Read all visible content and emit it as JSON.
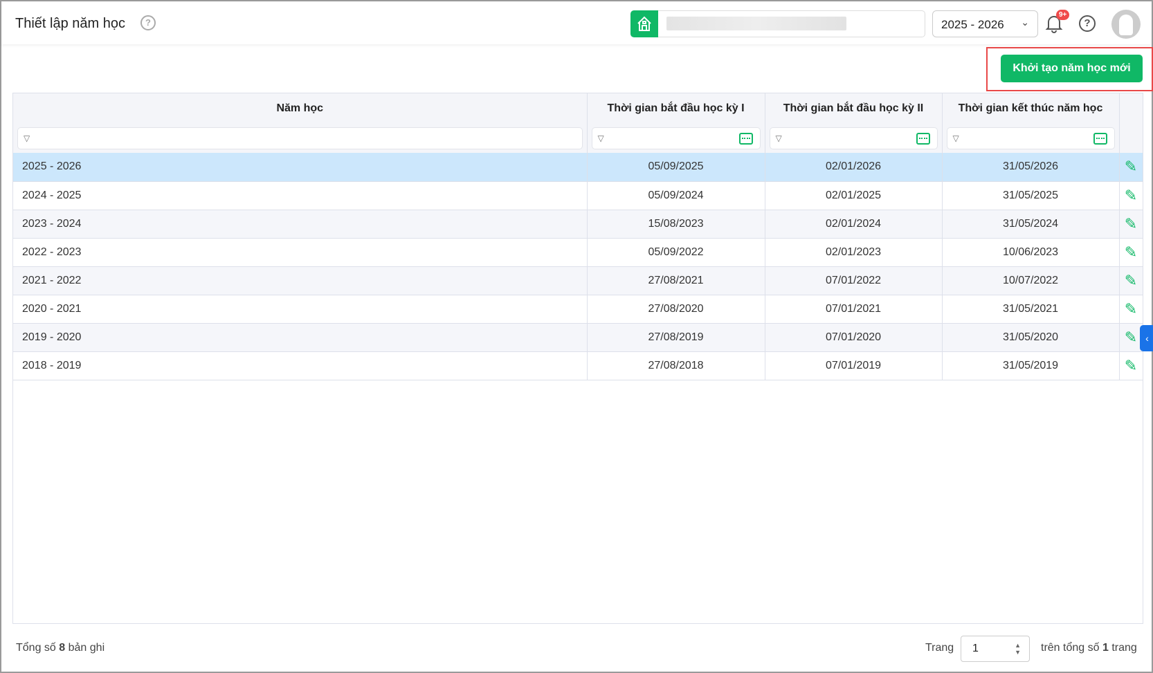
{
  "header": {
    "title": "Thiết lập năm học",
    "year": "2025 - 2026",
    "notif_badge": "9+"
  },
  "toolbar": {
    "new_label": "Khởi tạo năm học mới"
  },
  "table": {
    "columns": [
      "Năm học",
      "Thời gian bắt đầu học kỳ I",
      "Thời gian bắt đầu học kỳ II",
      "Thời gian kết thúc năm học"
    ],
    "rows": [
      [
        "2025 - 2026",
        "05/09/2025",
        "02/01/2026",
        "31/05/2026"
      ],
      [
        "2024 - 2025",
        "05/09/2024",
        "02/01/2025",
        "31/05/2025"
      ],
      [
        "2023 - 2024",
        "15/08/2023",
        "02/01/2024",
        "31/05/2024"
      ],
      [
        "2022 - 2023",
        "05/09/2022",
        "02/01/2023",
        "10/06/2023"
      ],
      [
        "2021 - 2022",
        "27/08/2021",
        "07/01/2022",
        "10/07/2022"
      ],
      [
        "2020 - 2021",
        "27/08/2020",
        "07/01/2021",
        "31/05/2021"
      ],
      [
        "2019 - 2020",
        "27/08/2019",
        "07/01/2020",
        "31/05/2020"
      ],
      [
        "2018 - 2019",
        "27/08/2018",
        "07/01/2019",
        "31/05/2019"
      ]
    ]
  },
  "footer": {
    "total_prefix": "Tổng số",
    "total": "8",
    "total_suffix": "bản ghi",
    "page_label": "Trang",
    "page": "1",
    "of_prefix": "trên tổng số",
    "pages": "1",
    "of_suffix": "trang"
  }
}
